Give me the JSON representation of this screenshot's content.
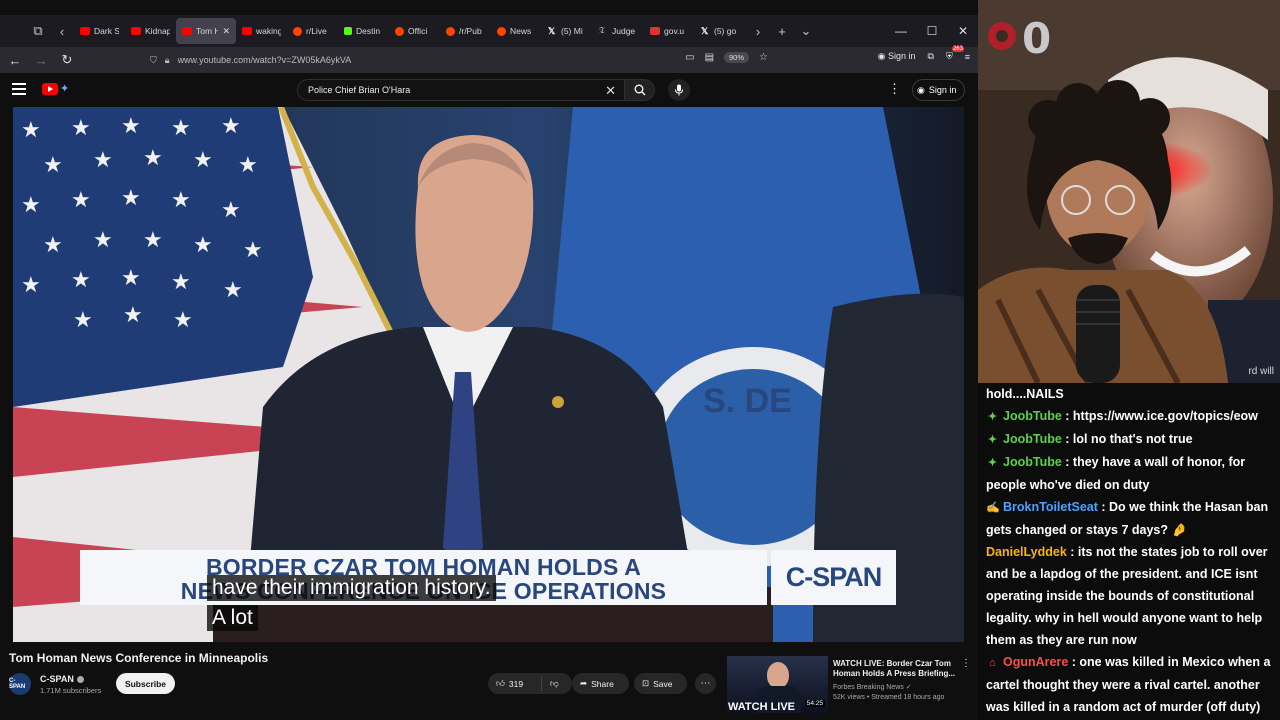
{
  "browser": {
    "tabs": [
      {
        "label": "Dark S",
        "icon": "yt"
      },
      {
        "label": "Kidnap",
        "icon": "yt"
      },
      {
        "label": "Tom H",
        "icon": "yt",
        "active": true
      },
      {
        "label": "waking",
        "icon": "yt"
      },
      {
        "label": "r/Live",
        "icon": "reddit"
      },
      {
        "label": "Destin",
        "icon": "kick"
      },
      {
        "label": "Offici",
        "icon": "reddit"
      },
      {
        "label": "/r/Pub",
        "icon": "reddit"
      },
      {
        "label": "News",
        "icon": "reddit"
      },
      {
        "label": "(5) Mi",
        "icon": "x"
      },
      {
        "label": "Judge",
        "icon": "times"
      },
      {
        "label": "gov.u",
        "icon": "gov"
      },
      {
        "label": "(5) go",
        "icon": "x"
      }
    ],
    "url": "www.youtube.com/watch?v=ZW05kA6ykVA",
    "zoom": "90%",
    "sign_in": "Sign in",
    "notification_count": "263"
  },
  "youtube": {
    "search_value": "Police Chief Brian O'Hara",
    "sign_in": "Sign in"
  },
  "video": {
    "lower_third_line1": "BORDER CZAR TOM HOMAN HOLDS A",
    "lower_third_line2": "NEWS CONFERENCE ON ICE OPERATIONS",
    "network": "C-SPAN",
    "caption_line1": "have their immigration history.",
    "caption_line2": "A lot"
  },
  "meta": {
    "title": "Tom Homan News Conference in Minneapolis",
    "channel": "C-SPAN",
    "channel_avatar": "C-SPAN",
    "subscribers": "1.71M subscribers",
    "subscribe": "Subscribe",
    "likes": "319",
    "share": "Share",
    "save": "Save"
  },
  "recommended": {
    "title": "WATCH LIVE: Border Czar Tom Homan Holds A Press Briefing...",
    "channel": "Forbes Breaking News",
    "meta": "52K views • Streamed 18 hours ago",
    "thumb_text": "WATCH LIVE",
    "duration": "54:25"
  },
  "stream": {
    "counter": "0",
    "cam_text": "rd will"
  },
  "chat": [
    {
      "user": "",
      "message": "hold....NAILS",
      "badge": "",
      "user_color": "#5dd14d"
    },
    {
      "user": "JoobTube",
      "message": "https://www.ice.gov/topics/eow",
      "badge": "✦",
      "user_color": "#5dd14d"
    },
    {
      "user": "JoobTube",
      "message": "lol no that's not true",
      "badge": "✦",
      "user_color": "#5dd14d"
    },
    {
      "user": "JoobTube",
      "message": "they have a wall of honor, for people who've died on duty",
      "badge": "✦",
      "user_color": "#5dd14d"
    },
    {
      "user": "BroknToiletSeat",
      "message": "Do we think the Hasan ban gets changed or stays 7 days? 🤌",
      "badge": "✍",
      "user_color": "#4aa3ff"
    },
    {
      "user": "DanielLyddek",
      "message": "its not the states job to roll over and be a lapdog of the president. and ICE isnt operating inside the bounds of constitutional legality. why in hell would anyone want to help them as they are run now",
      "badge": "",
      "user_color": "#f5b700"
    },
    {
      "user": "OgunArere",
      "message": "one was killed in Mexico when a cartel thought they were a rival cartel. another was killed in a random act of murder (off duty)",
      "badge": "⌂",
      "user_color": "#ff4d4d"
    }
  ]
}
